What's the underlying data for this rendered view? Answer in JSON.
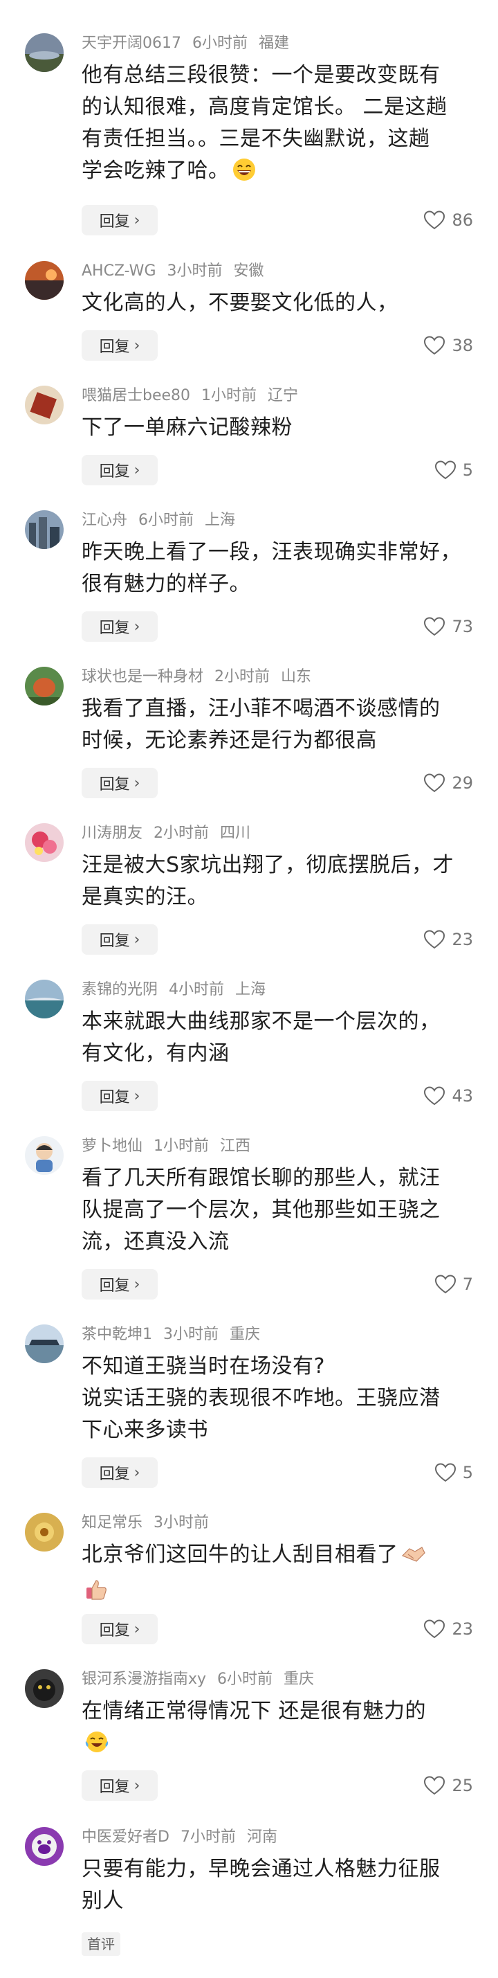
{
  "comments": [
    {
      "user": "天宇开阔0617",
      "time": "6小时前",
      "region": "福建",
      "lines": [
        "他有总结三段很赞：一个是要改变既有",
        "的认知很难，高度肯定馆长。 二是这趟",
        "有责任担当。。三是不失幽默说，这趟",
        "学会吃辣了哈。"
      ],
      "reply": "回复",
      "likes": "86",
      "emoji": "grin"
    },
    {
      "user": "AHCZ-WG",
      "time": "3小时前",
      "region": "安徽",
      "lines": [
        "文化高的人，不要娶文化低的人，"
      ],
      "reply": "回复",
      "likes": "38"
    },
    {
      "user": "喂猫居士bee80",
      "time": "1小时前",
      "region": "辽宁",
      "lines": [
        "下了一单麻六记酸辣粉"
      ],
      "reply": "回复",
      "likes": "5"
    },
    {
      "user": "江心舟",
      "time": "6小时前",
      "region": "上海",
      "lines": [
        "昨天晚上看了一段，汪表现确实非常好，",
        "很有魅力的样子。"
      ],
      "reply": "回复",
      "likes": "73"
    },
    {
      "user": "球状也是一种身材",
      "time": "2小时前",
      "region": "山东",
      "lines": [
        "我看了直播，汪小菲不喝酒不谈感情的",
        "时候，无论素养还是行为都很高"
      ],
      "reply": "回复",
      "likes": "29"
    },
    {
      "user": "川涛朋友",
      "time": "2小时前",
      "region": "四川",
      "lines": [
        "汪是被大S家坑出翔了，彻底摆脱后，才",
        "是真实的汪。"
      ],
      "reply": "回复",
      "likes": "23"
    },
    {
      "user": "素锦的光阴",
      "time": "4小时前",
      "region": "上海",
      "lines": [
        "本来就跟大曲线那家不是一个层次的，",
        "有文化，有内涵"
      ],
      "reply": "回复",
      "likes": "43"
    },
    {
      "user": "萝卜地仙",
      "time": "1小时前",
      "region": "江西",
      "lines": [
        "看了几天所有跟馆长聊的那些人，就汪",
        "队提高了一个层次，其他那些如王骁之",
        "流，还真没入流"
      ],
      "reply": "回复",
      "likes": "7"
    },
    {
      "user": "茶中乾坤1",
      "time": "3小时前",
      "region": "重庆",
      "lines": [
        "不知道王骁当时在场没有?",
        "说实话王骁的表现很不咋地。王骁应潜",
        "下心来多读书"
      ],
      "reply": "回复",
      "likes": "5"
    },
    {
      "user": "知足常乐",
      "time": "3小时前",
      "region": "",
      "lines": [
        "北京爷们这回牛的让人刮目相看了"
      ],
      "reply": "回复",
      "likes": "23",
      "emoji": "handshake"
    },
    {
      "user": "银河系漫游指南xy",
      "time": "6小时前",
      "region": "重庆",
      "lines": [
        "在情绪正常得情况下 还是很有魅力的"
      ],
      "reply": "回复",
      "likes": "25",
      "emoji": "tears"
    },
    {
      "user": "中医爱好者D",
      "time": "7小时前",
      "region": "河南",
      "lines": [
        "只要有能力，早晚会通过人格魅力征服",
        "别人"
      ],
      "badge": "首评"
    }
  ],
  "colors": {
    "meta": "#8a8a8a",
    "text": "#1f1f1f",
    "button_bg": "#f2f2f2"
  }
}
